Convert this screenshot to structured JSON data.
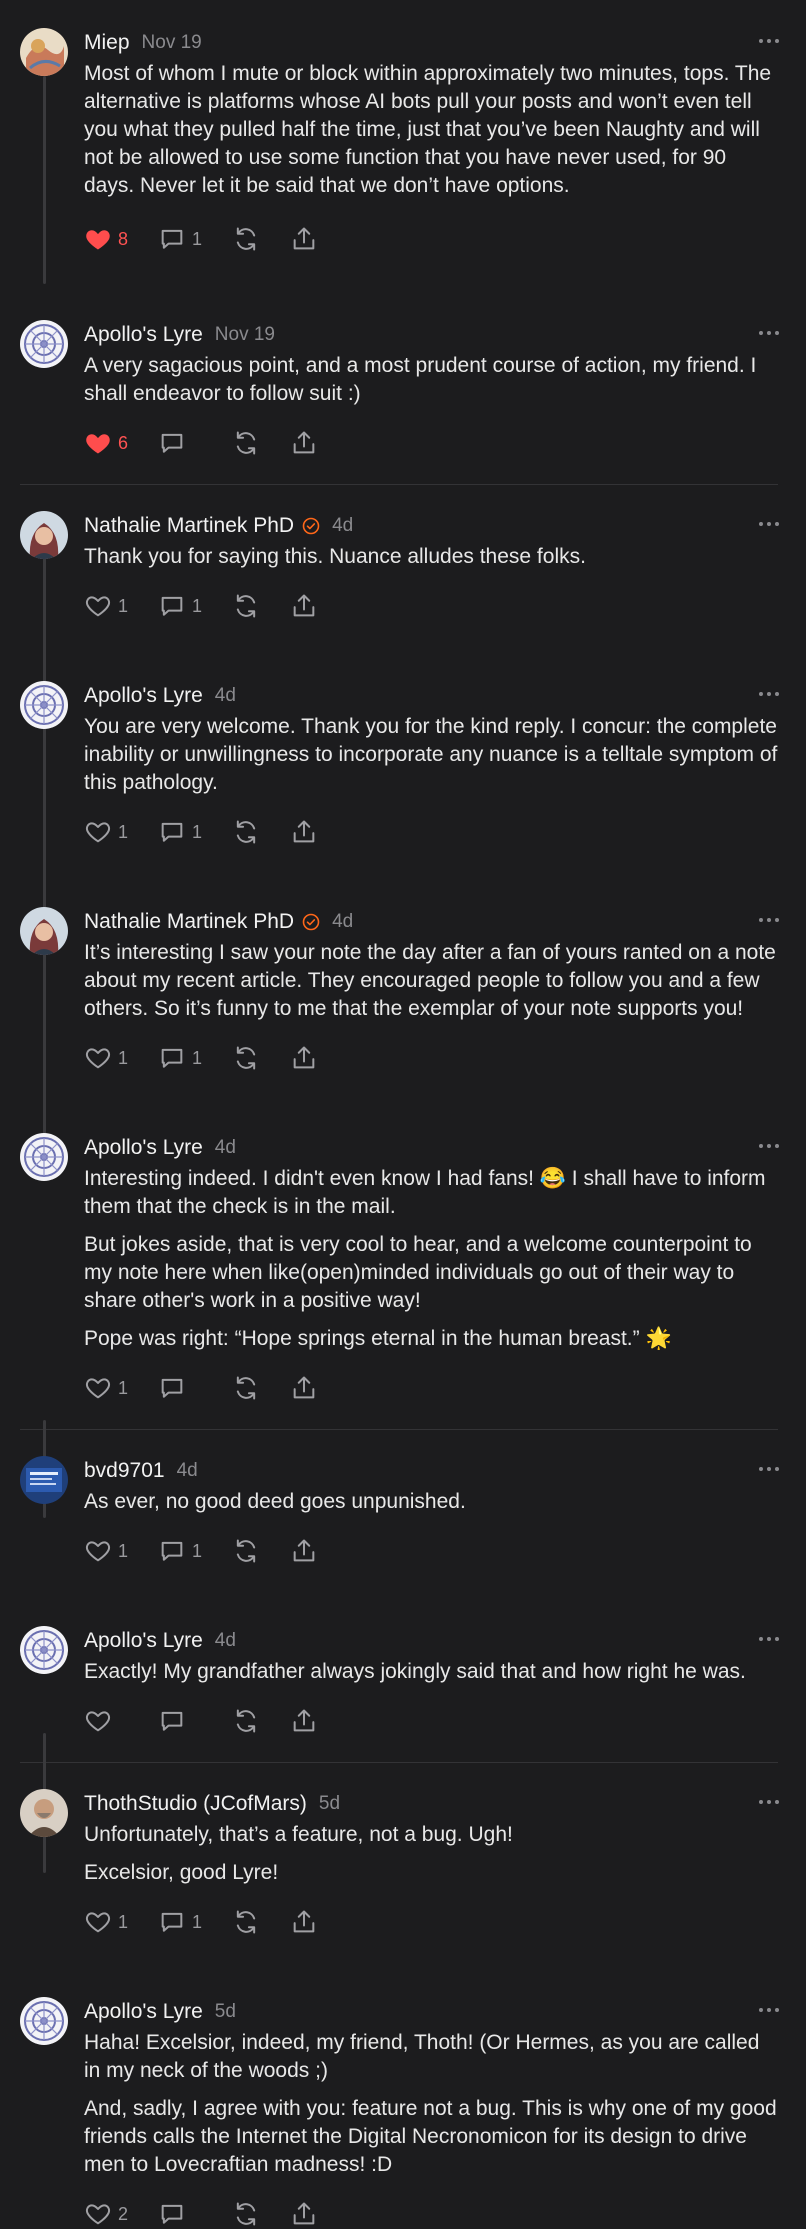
{
  "comments": [
    {
      "author": "Miep",
      "date": "Nov 19",
      "verified": false,
      "avatar": "avatar-miep",
      "paragraphs": [
        "Most of whom I mute or block within approximately two minutes, tops. The alternative is platforms whose AI bots pull your posts and won’t even tell you what they pulled half the time, just that you’ve been Naughty and will not be allowed to use some function that you have never used, for 90 days. Never let it be said that we don’t have options."
      ],
      "likes": "8",
      "liked": true,
      "replies": "1"
    },
    {
      "author": "Apollo's Lyre",
      "date": "Nov 19",
      "verified": false,
      "avatar": "avatar-apollo",
      "paragraphs": [
        "A very sagacious point, and a most prudent course of action, my friend. I shall endeavor to follow suit :)"
      ],
      "likes": "6",
      "liked": true,
      "replies": ""
    },
    {
      "author": "Nathalie Martinek PhD",
      "date": "4d",
      "verified": true,
      "avatar": "avatar-nathalie",
      "paragraphs": [
        "Thank you for saying this. Nuance alludes these folks."
      ],
      "likes": "1",
      "liked": false,
      "replies": "1"
    },
    {
      "author": "Apollo's Lyre",
      "date": "4d",
      "verified": false,
      "avatar": "avatar-apollo",
      "paragraphs": [
        "You are very welcome. Thank you for the kind reply. I concur: the complete inability or unwillingness to incorporate any nuance is a telltale symptom of this pathology."
      ],
      "likes": "1",
      "liked": false,
      "replies": "1"
    },
    {
      "author": "Nathalie Martinek PhD",
      "date": "4d",
      "verified": true,
      "avatar": "avatar-nathalie",
      "paragraphs": [
        "It’s interesting I saw your note the day after a fan of yours ranted on a note about my recent article. They encouraged people to follow you and a few others. So it’s funny to me that the exemplar of your note supports you!"
      ],
      "likes": "1",
      "liked": false,
      "replies": "1"
    },
    {
      "author": "Apollo's Lyre",
      "date": "4d",
      "verified": false,
      "avatar": "avatar-apollo",
      "paragraphs": [
        "Interesting indeed. I didn't even know I had fans! 😂 I shall have to inform them that the check is in the mail.",
        "But jokes aside, that is very cool to hear, and a welcome counterpoint to my note here when like(open)minded individuals go out of their way to share other's work in a positive way!",
        "Pope was right: “Hope springs eternal in the human breast.” 🌟"
      ],
      "likes": "1",
      "liked": false,
      "replies": ""
    },
    {
      "author": "bvd9701",
      "date": "4d",
      "verified": false,
      "avatar": "avatar-bvd",
      "paragraphs": [
        "As ever, no good deed goes unpunished."
      ],
      "likes": "1",
      "liked": false,
      "replies": "1"
    },
    {
      "author": "Apollo's Lyre",
      "date": "4d",
      "verified": false,
      "avatar": "avatar-apollo",
      "paragraphs": [
        "Exactly! My grandfather always jokingly said that and how right he was."
      ],
      "likes": "",
      "liked": false,
      "replies": ""
    },
    {
      "author": "ThothStudio (JCofMars)",
      "date": "5d",
      "verified": false,
      "avatar": "avatar-thoth",
      "paragraphs": [
        "Unfortunately, that’s a feature, not a bug. Ugh!",
        "Excelsior, good Lyre!"
      ],
      "likes": "1",
      "liked": false,
      "replies": "1"
    },
    {
      "author": "Apollo's Lyre",
      "date": "5d",
      "verified": false,
      "avatar": "avatar-apollo",
      "paragraphs": [
        "Haha! Excelsior, indeed, my friend, Thoth! (Or Hermes, as you are called in my neck of the woods ;)",
        "And, sadly, I agree with you: feature not a bug. This is why one of my good friends calls the Internet the Digital Necronomicon for its design to drive men to Lovecraftian madness! :D"
      ],
      "likes": "2",
      "liked": false,
      "replies": ""
    }
  ],
  "colors": {
    "background": "#1c1c1e",
    "like_active": "#ff4d4d",
    "verified": "#ff6719",
    "muted": "#8a8a8e"
  }
}
